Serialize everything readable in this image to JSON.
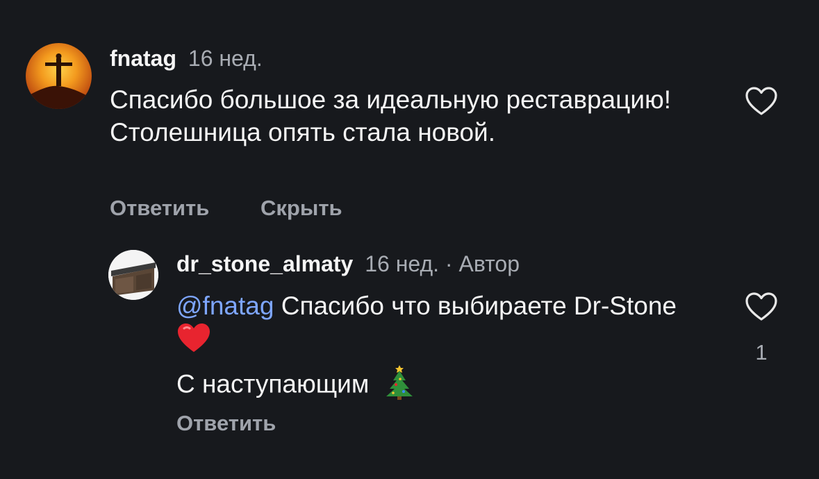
{
  "comment": {
    "username": "fnatag",
    "time": "16 нед.",
    "text": "Спасибо большое за идеальную реставрацию! Столешница опять  стала новой.",
    "reply_label": "Ответить",
    "hide_label": "Скрыть"
  },
  "reply": {
    "username": "dr_stone_almaty",
    "time": "16 нед.",
    "author_label": "· Автор",
    "mention": "@fnatag",
    "text": "Спасибо что выбираете Dr-Stone",
    "line2": "С наступающим",
    "reply_label": "Ответить",
    "like_count": "1"
  },
  "icons": {
    "heart": "heart-outline-icon",
    "red_heart": "red-heart-emoji",
    "tree": "christmas-tree-emoji"
  },
  "colors": {
    "background": "#17191d",
    "mention": "#7ea6ff",
    "muted": "#a8acb3"
  }
}
